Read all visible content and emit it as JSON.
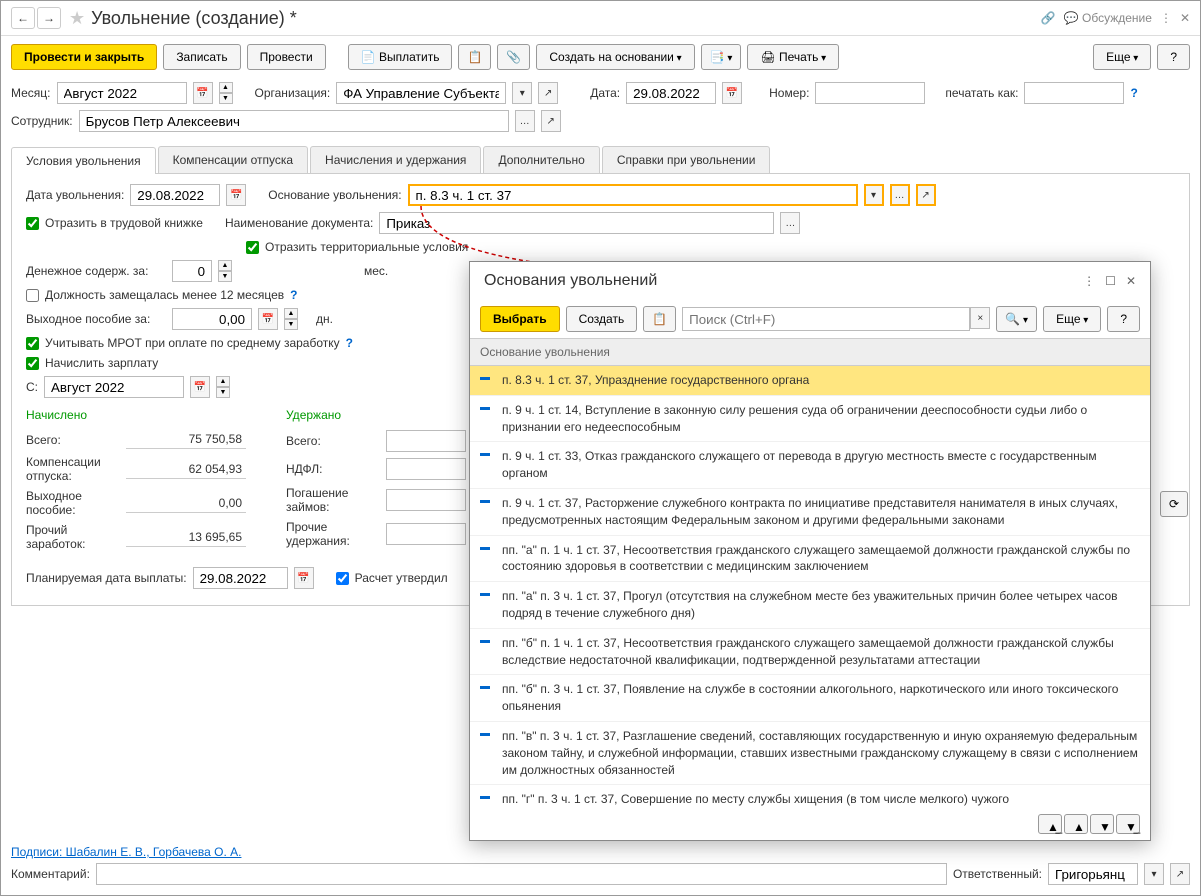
{
  "header": {
    "title": "Увольнение (создание) *",
    "discuss": "Обсуждение"
  },
  "toolbar": {
    "post_close": "Провести и закрыть",
    "write": "Записать",
    "post": "Провести",
    "pay": "Выплатить",
    "create_based": "Создать на основании",
    "print": "Печать",
    "more": "Еще",
    "help": "?"
  },
  "fields": {
    "month_label": "Месяц:",
    "month_value": "Август 2022",
    "org_label": "Организация:",
    "org_value": "ФА Управление Субъекта Фе",
    "date_label": "Дата:",
    "date_value": "29.08.2022",
    "number_label": "Номер:",
    "print_as_label": "печатать как:",
    "employee_label": "Сотрудник:",
    "employee_value": "Брусов Петр Алексеевич"
  },
  "tabs": [
    "Условия увольнения",
    "Компенсации отпуска",
    "Начисления и удержания",
    "Дополнительно",
    "Справки при увольнении"
  ],
  "dismissal": {
    "date_label": "Дата увольнения:",
    "date_value": "29.08.2022",
    "reason_label": "Основание увольнения:",
    "reason_value": "п. 8.3 ч. 1 ст. 37",
    "workbook_check": "Отразить в трудовой книжке",
    "doc_name_label": "Наименование документа:",
    "doc_name_value": "Приказ",
    "territorial_check": "Отразить территориальные условия",
    "money_label": "Денежное содерж. за:",
    "money_value": "0",
    "months": "мес.",
    "position_check": "Должность замещалась менее 12 месяцев",
    "severance_label": "Выходное пособие за:",
    "severance_value": "0,00",
    "days": "дн.",
    "mrot_check": "Учитывать МРОТ при оплате по среднему заработку",
    "salary_check": "Начислить зарплату",
    "from_label": "С:",
    "from_value": "Август 2022"
  },
  "summary": {
    "accrued": "Начислено",
    "withheld": "Удержано",
    "total_label": "Всего:",
    "total_accrued": "75 750,58",
    "vacation_label": "Компенсации отпуска:",
    "vacation_value": "62 054,93",
    "ndfl_label": "НДФЛ:",
    "severance_s_label": "Выходное пособие:",
    "severance_s_value": "0,00",
    "loans_label": "Погашение займов:",
    "other_earn_label": "Прочий заработок:",
    "other_earn_value": "13 695,65",
    "other_withhold_label": "Прочие удержания:",
    "planned_date_label": "Планируемая дата выплаты:",
    "planned_date_value": "29.08.2022",
    "approved_check": "Расчет утвердил"
  },
  "footer": {
    "signatures": "Подписи: Шабалин Е. В., Горбачева О. А.",
    "comment_label": "Комментарий:",
    "responsible_label": "Ответственный:",
    "responsible_value": "Григорьянц"
  },
  "popup": {
    "title": "Основания увольнений",
    "select": "Выбрать",
    "create": "Создать",
    "search_placeholder": "Поиск (Ctrl+F)",
    "more": "Еще",
    "list_header": "Основание увольнения",
    "items": [
      "п. 8.3 ч. 1 ст. 37, Упразднение государственного органа",
      "п. 9 ч. 1 ст. 14, Вступление в законную силу решения суда об ограничении дееспособности судьи либо о признании его недееспособным",
      "п. 9 ч. 1 ст. 33, Отказ гражданского служащего от перевода в другую местность вместе с государственным органом",
      "п. 9 ч. 1 ст. 37, Расторжение служебного контракта по инициативе представителя нанимателя в иных случаях, предусмотренных настоящим Федеральным законом и другими федеральными законами",
      "пп. \"а\" п. 1 ч. 1 ст. 37, Несоответствия гражданского служащего замещаемой должности гражданской службы по состоянию здоровья в соответствии с медицинским заключением",
      "пп. \"а\" п. 3 ч. 1 ст. 37, Прогул (отсутствия на служебном месте без уважительных причин более четырех часов подряд в течение служебного дня)",
      "пп. \"б\" п. 1 ч. 1 ст. 37, Несоответствия гражданского служащего замещаемой должности гражданской службы вследствие недостаточной квалификации, подтвержденной результатами аттестации",
      "пп. \"б\" п. 3 ч. 1 ст. 37, Появление на службе в состоянии алкогольного, наркотического или иного токсического опьянения",
      "пп. \"в\" п. 3 ч. 1 ст. 37, Разглашение сведений, составляющих государственную и иную охраняемую федеральным законом тайну, и служебной информации, ставших известными гражданскому служащему в связи с исполнением им должностных обязанностей",
      "пп. \"г\" п. 3 ч. 1 ст. 37, Совершение по месту службы хищения (в том числе мелкого) чужого"
    ]
  }
}
